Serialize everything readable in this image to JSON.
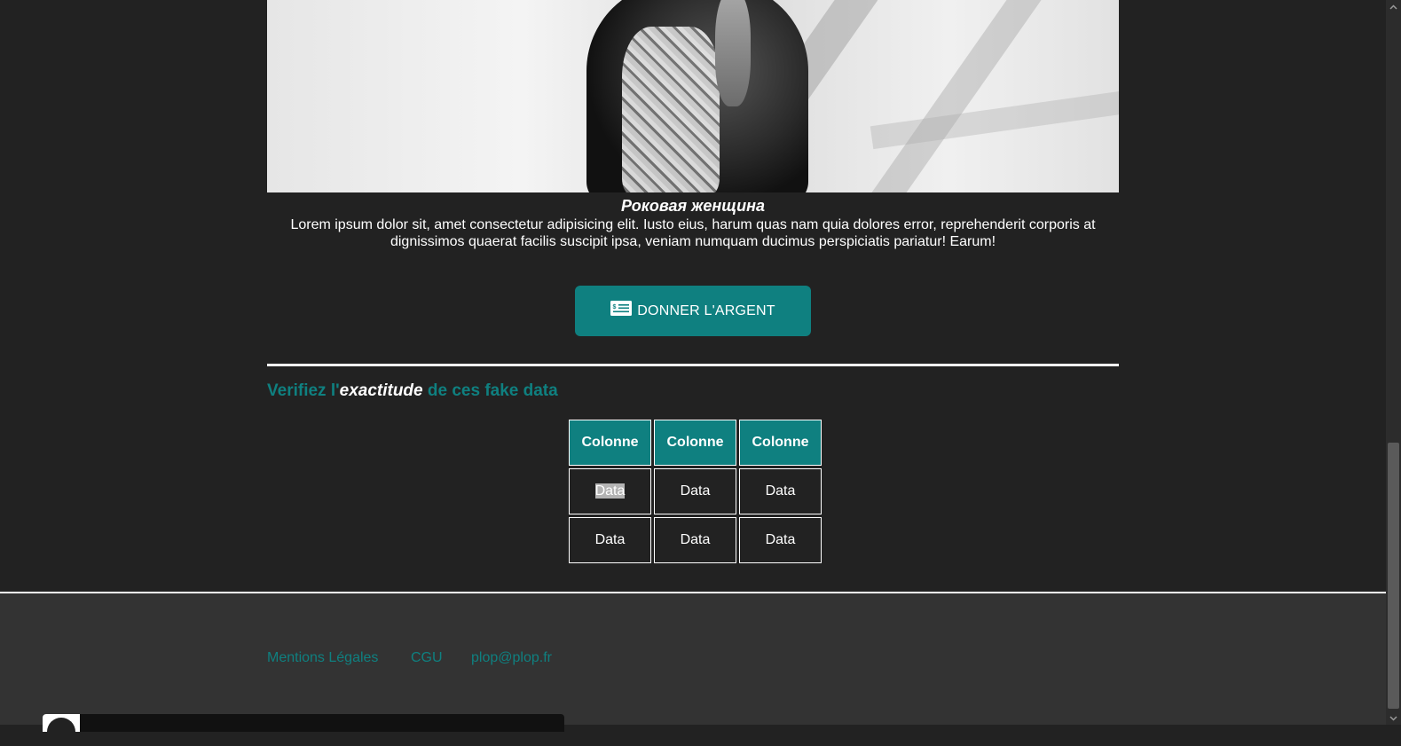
{
  "article": {
    "title": "Роковая женщина",
    "text": "Lorem ipsum dolor sit, amet consectetur adipisicing elit. Iusto eius, harum quas nam quia dolores error, reprehenderit corporis at dignissimos quaerat facilis suscipit ipsa, veniam numquam ducimus perspiciatis pariatur! Earum!"
  },
  "donate_button": {
    "label": "DONNER L'ARGENT",
    "icon": "money-bill-icon"
  },
  "verify_heading": {
    "part1": "Verifiez l'",
    "emphasis": "exactitude",
    "part2": " de ces fake data"
  },
  "table": {
    "headers": [
      "Colonne",
      "Colonne",
      "Colonne"
    ],
    "rows": [
      [
        "Data",
        "Data",
        "Data"
      ],
      [
        "Data",
        "Data",
        "Data"
      ]
    ]
  },
  "footer": {
    "links": [
      "Mentions Légales",
      "CGU",
      "plop@plop.fr"
    ]
  },
  "colors": {
    "accent": "#0f8080",
    "background": "#222222",
    "footer_background": "#333333"
  }
}
